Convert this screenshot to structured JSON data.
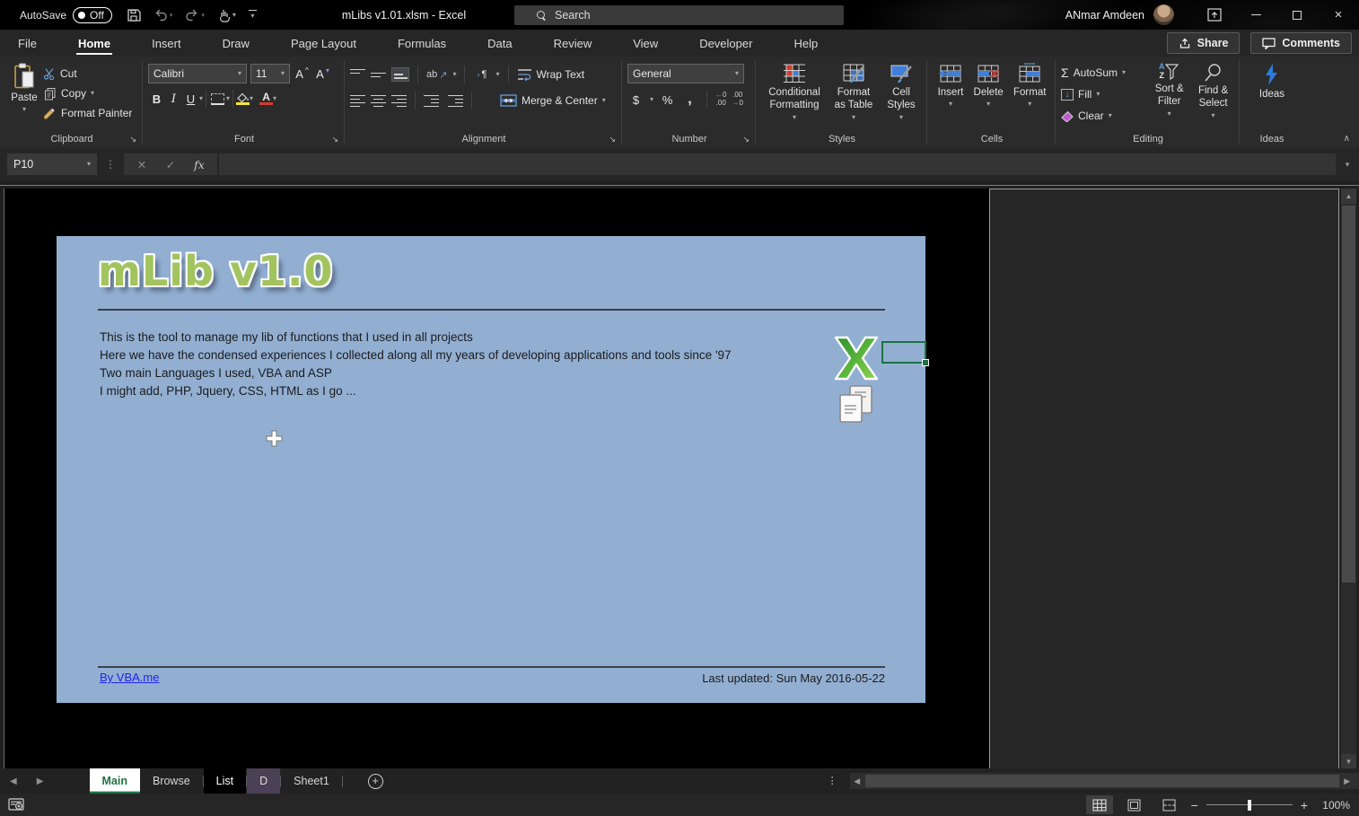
{
  "titlebar": {
    "autosave_label": "AutoSave",
    "autosave_state": "Off",
    "document_title": "mLibs v1.01.xlsm  -  Excel",
    "search_placeholder": "Search",
    "user_name": "ANmar Amdeen"
  },
  "ribbon_tabs": [
    {
      "label": "File"
    },
    {
      "label": "Home",
      "active": true
    },
    {
      "label": "Insert"
    },
    {
      "label": "Draw"
    },
    {
      "label": "Page Layout"
    },
    {
      "label": "Formulas"
    },
    {
      "label": "Data"
    },
    {
      "label": "Review"
    },
    {
      "label": "View"
    },
    {
      "label": "Developer"
    },
    {
      "label": "Help"
    }
  ],
  "top_actions": {
    "share": "Share",
    "comments": "Comments"
  },
  "ribbon": {
    "clipboard": {
      "title": "Clipboard",
      "paste": "Paste",
      "cut": "Cut",
      "copy": "Copy",
      "format_painter": "Format Painter"
    },
    "font": {
      "title": "Font",
      "family": "Calibri",
      "size": "11",
      "bold": "B",
      "italic": "I",
      "underline": "U"
    },
    "alignment": {
      "title": "Alignment",
      "orientation": "ab",
      "wrap_text": "Wrap Text",
      "merge_center": "Merge & Center"
    },
    "number": {
      "title": "Number",
      "format": "General",
      "currency": "$",
      "percent": "%",
      "comma": ",",
      "inc_decimal": ".00",
      "dec_decimal": ".00"
    },
    "styles": {
      "title": "Styles",
      "conditional_formatting": "Conditional Formatting",
      "format_as_table": "Format as Table",
      "cell_styles": "Cell Styles"
    },
    "cells": {
      "title": "Cells",
      "insert": "Insert",
      "delete": "Delete",
      "format": "Format"
    },
    "editing": {
      "title": "Editing",
      "autosum": "AutoSum",
      "fill": "Fill",
      "clear": "Clear",
      "sort_filter": "Sort & Filter",
      "find_select": "Find & Select"
    },
    "ideas": {
      "title": "Ideas",
      "button": "Ideas"
    }
  },
  "formula_bar": {
    "cell_ref": "P10",
    "fx_label": "fx"
  },
  "worksheet": {
    "title": "mLib v1.0",
    "description_lines": [
      "This is the tool to manage my lib of functions that I used in all projects",
      "Here we have the condensed experiences I collected along all my years of developing applications and tools since '97",
      "Two main Languages I used, VBA and ASP",
      "I might add, PHP, Jquery, CSS, HTML as I go ..."
    ],
    "byline": "By VBA.me",
    "last_updated": "Last updated: Sun May 2016-05-22",
    "active_cell": "P10"
  },
  "sheet_tabs": [
    {
      "label": "Main",
      "active": true
    },
    {
      "label": "Browse"
    },
    {
      "label": "List",
      "tab_color": "#000000"
    },
    {
      "label": "D",
      "tab_color": "#4a4156"
    },
    {
      "label": "Sheet1"
    }
  ],
  "status_bar": {
    "zoom_level": "100%"
  },
  "colors": {
    "excel_green": "#217346",
    "panel_blue": "#92afd2",
    "title_green": "#a2c45f",
    "link_blue": "#2222ee",
    "fill_yellow": "#f3e73b",
    "font_red": "#d43b2e",
    "accent_blue": "#3f7fd9",
    "tab_list_color": "#000000",
    "tab_d_color": "#4a4156"
  }
}
